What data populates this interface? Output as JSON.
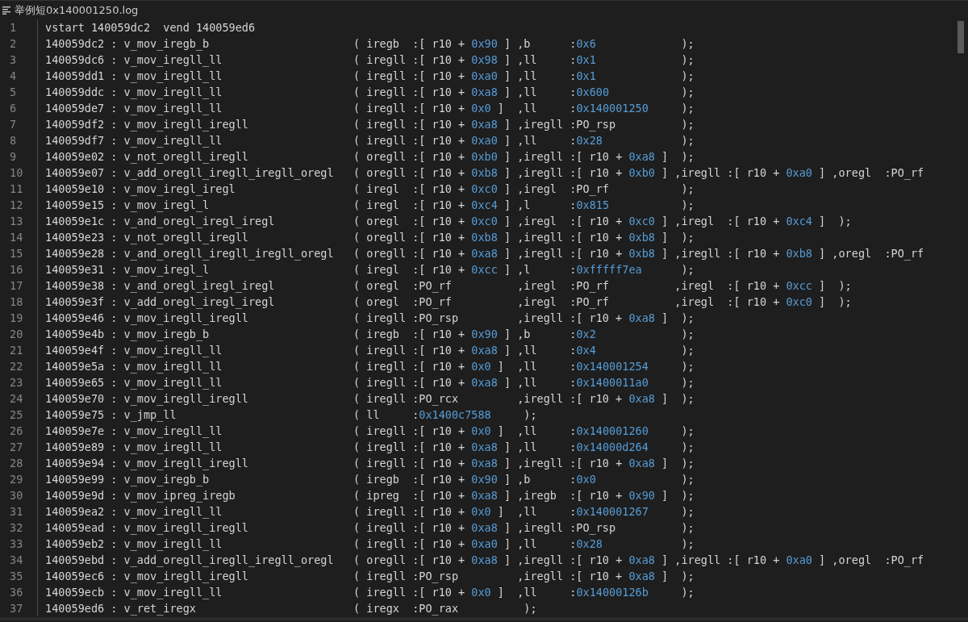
{
  "editor": {
    "tab_title": "举例短0x140001250.log",
    "lines": [
      {
        "number": "1",
        "text": "vstart 140059dc2  vend 140059ed6"
      },
      {
        "number": "2",
        "text": "140059dc2 : v_mov_iregb_b                      ( iregb  :[ r10 + 0x90 ] ,b      :0x6             );"
      },
      {
        "number": "3",
        "text": "140059dc6 : v_mov_iregll_ll                    ( iregll :[ r10 + 0x98 ] ,ll     :0x1             );"
      },
      {
        "number": "4",
        "text": "140059dd1 : v_mov_iregll_ll                    ( iregll :[ r10 + 0xa0 ] ,ll     :0x1             );"
      },
      {
        "number": "5",
        "text": "140059ddc : v_mov_iregll_ll                    ( iregll :[ r10 + 0xa8 ] ,ll     :0x600           );"
      },
      {
        "number": "6",
        "text": "140059de7 : v_mov_iregll_ll                    ( iregll :[ r10 + 0x0 ]  ,ll     :0x140001250     );"
      },
      {
        "number": "7",
        "text": "140059df2 : v_mov_iregll_iregll                ( iregll :[ r10 + 0xa8 ] ,iregll :PO_rsp          );"
      },
      {
        "number": "8",
        "text": "140059df7 : v_mov_iregll_ll                    ( iregll :[ r10 + 0xa0 ] ,ll     :0x28            );"
      },
      {
        "number": "9",
        "text": "140059e02 : v_not_oregll_iregll                ( oregll :[ r10 + 0xb0 ] ,iregll :[ r10 + 0xa8 ]  );"
      },
      {
        "number": "10",
        "text": "140059e07 : v_add_oregll_iregll_iregll_oregl   ( oregll :[ r10 + 0xb8 ] ,iregll :[ r10 + 0xb0 ] ,iregll :[ r10 + 0xa0 ] ,oregl  :PO_rf"
      },
      {
        "number": "11",
        "text": "140059e10 : v_mov_iregl_iregl                  ( iregl  :[ r10 + 0xc0 ] ,iregl  :PO_rf           );"
      },
      {
        "number": "12",
        "text": "140059e15 : v_mov_iregl_l                      ( iregl  :[ r10 + 0xc4 ] ,l      :0x815           );"
      },
      {
        "number": "13",
        "text": "140059e1c : v_and_oregl_iregl_iregl            ( oregl  :[ r10 + 0xc0 ] ,iregl  :[ r10 + 0xc0 ] ,iregl  :[ r10 + 0xc4 ]  );"
      },
      {
        "number": "14",
        "text": "140059e23 : v_not_oregll_iregll                ( oregll :[ r10 + 0xb8 ] ,iregll :[ r10 + 0xb8 ]  );"
      },
      {
        "number": "15",
        "text": "140059e28 : v_and_oregll_iregll_iregll_oregl   ( oregll :[ r10 + 0xa8 ] ,iregll :[ r10 + 0xb8 ] ,iregll :[ r10 + 0xb8 ] ,oregl  :PO_rf"
      },
      {
        "number": "16",
        "text": "140059e31 : v_mov_iregl_l                      ( iregl  :[ r10 + 0xcc ] ,l      :0xfffff7ea      );"
      },
      {
        "number": "17",
        "text": "140059e38 : v_and_oregl_iregl_iregl            ( oregl  :PO_rf          ,iregl  :PO_rf          ,iregl  :[ r10 + 0xcc ]  );"
      },
      {
        "number": "18",
        "text": "140059e3f : v_add_oregl_iregl_iregl            ( oregl  :PO_rf          ,iregl  :PO_rf          ,iregl  :[ r10 + 0xc0 ]  );"
      },
      {
        "number": "19",
        "text": "140059e46 : v_mov_iregll_iregll                ( iregll :PO_rsp         ,iregll :[ r10 + 0xa8 ]  );"
      },
      {
        "number": "20",
        "text": "140059e4b : v_mov_iregb_b                      ( iregb  :[ r10 + 0x90 ] ,b      :0x2             );"
      },
      {
        "number": "21",
        "text": "140059e4f : v_mov_iregll_ll                    ( iregll :[ r10 + 0xa8 ] ,ll     :0x4             );"
      },
      {
        "number": "22",
        "text": "140059e5a : v_mov_iregll_ll                    ( iregll :[ r10 + 0x0 ]  ,ll     :0x140001254     );"
      },
      {
        "number": "23",
        "text": "140059e65 : v_mov_iregll_ll                    ( iregll :[ r10 + 0xa8 ] ,ll     :0x1400011a0     );"
      },
      {
        "number": "24",
        "text": "140059e70 : v_mov_iregll_iregll                ( iregll :PO_rcx         ,iregll :[ r10 + 0xa8 ]  );"
      },
      {
        "number": "25",
        "text": "140059e75 : v_jmp_ll                           ( ll     :0x1400c7588     );"
      },
      {
        "number": "26",
        "text": "140059e7e : v_mov_iregll_ll                    ( iregll :[ r10 + 0x0 ]  ,ll     :0x140001260     );"
      },
      {
        "number": "27",
        "text": "140059e89 : v_mov_iregll_ll                    ( iregll :[ r10 + 0xa8 ] ,ll     :0x14000d264     );"
      },
      {
        "number": "28",
        "text": "140059e94 : v_mov_iregll_iregll                ( iregll :[ r10 + 0xa8 ] ,iregll :[ r10 + 0xa8 ]  );"
      },
      {
        "number": "29",
        "text": "140059e99 : v_mov_iregb_b                      ( iregb  :[ r10 + 0x90 ] ,b      :0x0             );"
      },
      {
        "number": "30",
        "text": "140059e9d : v_mov_ipreg_iregb                  ( ipreg  :[ r10 + 0xa8 ] ,iregb  :[ r10 + 0x90 ]  );"
      },
      {
        "number": "31",
        "text": "140059ea2 : v_mov_iregll_ll                    ( iregll :[ r10 + 0x0 ]  ,ll     :0x140001267     );"
      },
      {
        "number": "32",
        "text": "140059ead : v_mov_iregll_iregll                ( iregll :[ r10 + 0xa8 ] ,iregll :PO_rsp          );"
      },
      {
        "number": "33",
        "text": "140059eb2 : v_mov_iregll_ll                    ( iregll :[ r10 + 0xa0 ] ,ll     :0x28            );"
      },
      {
        "number": "34",
        "text": "140059ebd : v_add_oregll_iregll_iregll_oregl   ( oregll :[ r10 + 0xa8 ] ,iregll :[ r10 + 0xa8 ] ,iregll :[ r10 + 0xa0 ] ,oregl  :PO_rf"
      },
      {
        "number": "35",
        "text": "140059ec6 : v_mov_iregll_iregll                ( iregll :PO_rsp         ,iregll :[ r10 + 0xa8 ]  );"
      },
      {
        "number": "36",
        "text": "140059ecb : v_mov_iregll_ll                    ( iregll :[ r10 + 0x0 ]  ,ll     :0x14000126b     );"
      },
      {
        "number": "37",
        "text": "140059ed6 : v_ret_iregx                        ( iregx  :PO_rax          );"
      }
    ]
  }
}
